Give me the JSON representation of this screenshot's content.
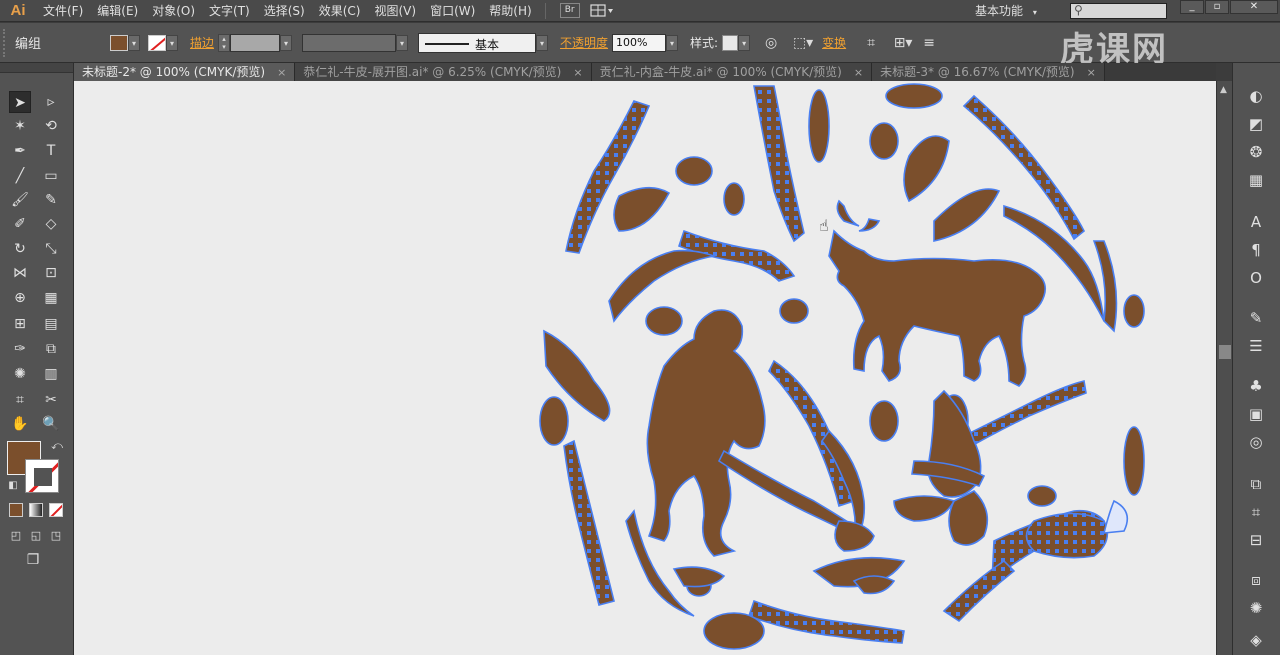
{
  "app": {
    "logo": "Ai"
  },
  "menu": [
    {
      "label": "文件(F)"
    },
    {
      "label": "编辑(E)"
    },
    {
      "label": "对象(O)"
    },
    {
      "label": "文字(T)"
    },
    {
      "label": "选择(S)"
    },
    {
      "label": "效果(C)"
    },
    {
      "label": "视图(V)"
    },
    {
      "label": "窗口(W)"
    },
    {
      "label": "帮助(H)"
    }
  ],
  "bridge_label": "Br",
  "workspace_label": "基本功能",
  "watermark": "虎课网",
  "control": {
    "selection_label": "编组",
    "stroke_label": "描边",
    "stroke_profile": "基本",
    "opacity_label": "不透明度",
    "opacity_value": "100%",
    "style_label": "样式:",
    "transform_label": "变换",
    "fill_color": "#7b4f2c",
    "accent_color": "#f0a030"
  },
  "tabs": [
    {
      "label": "未标题-2* @ 100% (CMYK/预览)",
      "active": true
    },
    {
      "label": "恭仁礼-牛皮-展开图.ai* @ 6.25% (CMYK/预览)",
      "active": false
    },
    {
      "label": "贡仁礼-内盒-牛皮.ai* @ 100% (CMYK/预览)",
      "active": false
    },
    {
      "label": "未标题-3* @ 16.67% (CMYK/预览)",
      "active": false
    }
  ],
  "colors": {
    "artwork_fill": "#7b4f2c",
    "anchor_blue": "#4a7ff0",
    "canvas_bg": "#ececec"
  }
}
